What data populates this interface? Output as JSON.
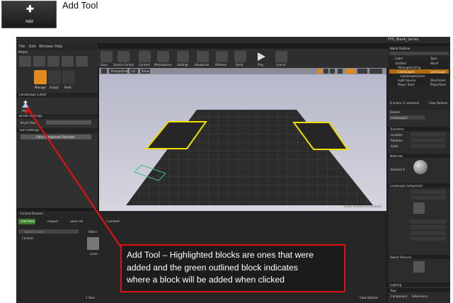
{
  "header": {
    "add_icon_label": "Add",
    "title": "Add Tool"
  },
  "editor": {
    "window_title": "FPS_Blank_Series",
    "menu": [
      "File",
      "Edit",
      "Window",
      "Help"
    ],
    "modes": {
      "tab": "Modes",
      "tools": [
        {
          "label": "Manage",
          "selected": true
        },
        {
          "label": "Sculpt",
          "selected": false
        },
        {
          "label": "Paint",
          "selected": false
        }
      ]
    },
    "landscape_editor": {
      "section": "Landscape Editor",
      "add_tool_label": "Add",
      "brush_settings": "Brush Settings",
      "brush_size_label": "Brush Size",
      "tool_settings": "Tool Settings",
      "clear_button": "Clear Component Selection"
    },
    "toolbar": [
      {
        "label": "Save",
        "icon": "save-icon"
      },
      {
        "label": "Source Control",
        "icon": "source-control-icon"
      },
      {
        "label": "Content",
        "icon": "content-icon"
      },
      {
        "label": "Marketplace",
        "icon": "marketplace-icon"
      },
      {
        "label": "Settings",
        "icon": "settings-icon"
      },
      {
        "label": "Blueprints",
        "icon": "blueprints-icon"
      },
      {
        "label": "Matinee",
        "icon": "matinee-icon"
      },
      {
        "label": "Build",
        "icon": "build-icon"
      },
      {
        "label": "Play",
        "icon": "play-icon"
      },
      {
        "label": "Launch",
        "icon": "launch-icon"
      }
    ],
    "viewport": {
      "perspective": "Perspective",
      "lit": "Lit",
      "show": "Show",
      "footer": "Level: Untitled (Persistent)"
    },
    "outliner": {
      "tab": "World Outliner",
      "col_label": "Label",
      "col_type": "Type",
      "rows": [
        {
          "label": "Untitled",
          "type": "World"
        },
        {
          "label": "AtmosphericFog",
          "type": ""
        },
        {
          "label": "Landscape1",
          "type": "Landscape"
        },
        {
          "label": "LandscapeGizmo",
          "type": ""
        },
        {
          "label": "Light Source",
          "type": "Directional"
        },
        {
          "label": "Player Start",
          "type": "PlayerStart"
        }
      ],
      "footer": "8 actors (1 selected)",
      "view_options": "View Options"
    },
    "details": {
      "tab": "Details",
      "name": "Landscape1",
      "transform": "Transform",
      "location": "Location",
      "rotation": "Rotation",
      "scale": "Scale",
      "materials": "Materials",
      "element": "Element 0",
      "landscape_component": "Landscape Component",
      "baked_textures": "Baked Textures",
      "lighting": "Lighting",
      "tags": "Tags",
      "component": "Component",
      "extension": "Extensions"
    },
    "content_browser": {
      "tab": "Content Browser",
      "add_new": "Add New",
      "import": "Import",
      "save_all": "Save All",
      "path": "Content",
      "search_folders": "Search Folders",
      "folder": "Content",
      "filters": "Filters",
      "item_label": "Level",
      "items_count": "1 item",
      "view_options": "View Options"
    }
  },
  "callout": {
    "lines": [
      "Add Tool – Highlighted blocks are ones that were",
      "added and the green outlined block indicates",
      "where a block will be added when clicked"
    ],
    "border_color": "#e01010",
    "arrow_color": "#e01010"
  },
  "colors": {
    "highlight": "#f0e000",
    "preview_outline": "#40c080",
    "selected_tool": "#e08a1e"
  }
}
